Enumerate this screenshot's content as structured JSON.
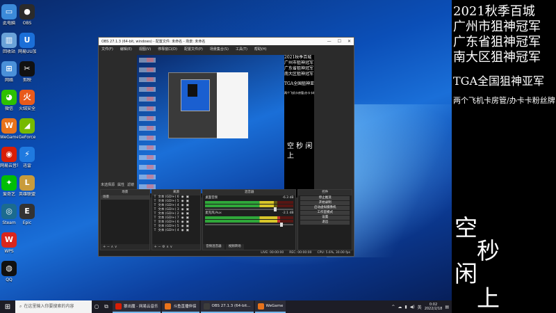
{
  "desktop": {
    "icons": [
      {
        "label": "此电脑",
        "icon": "computer-icon",
        "color": "#3b8ad9",
        "glyph": "▭"
      },
      {
        "label": "回收站",
        "icon": "recycle-bin-icon",
        "color": "#6aa2d8",
        "glyph": "▥"
      },
      {
        "label": "网络",
        "icon": "network-icon",
        "color": "#4a90d9",
        "glyph": "⊞"
      },
      {
        "label": "微信",
        "icon": "wechat-icon",
        "color": "#2dc100",
        "glyph": "◕"
      },
      {
        "label": "WeGame",
        "icon": "wegame-icon",
        "color": "#e8731b",
        "glyph": "W"
      },
      {
        "label": "网易云音乐",
        "icon": "netease-music-icon",
        "color": "#d81e06",
        "glyph": "◉"
      },
      {
        "label": "爱奇艺",
        "icon": "iqiyi-icon",
        "color": "#00be06",
        "glyph": "✦"
      },
      {
        "label": "Steam",
        "icon": "steam-icon",
        "color": "#1b6b8f",
        "glyph": "◎"
      },
      {
        "label": "WPS",
        "icon": "wps-icon",
        "color": "#d9261c",
        "glyph": "W"
      },
      {
        "label": "QQ",
        "icon": "qq-icon",
        "color": "#111111",
        "glyph": "◍"
      },
      {
        "label": "OBS",
        "icon": "obs-icon",
        "color": "#2b2b2b",
        "glyph": "●"
      },
      {
        "label": "网易UU加速器",
        "icon": "uu-accelerator-icon",
        "color": "#1b6fd8",
        "glyph": "U"
      },
      {
        "label": "剪映",
        "icon": "capcut-icon",
        "color": "#111111",
        "glyph": "✂"
      },
      {
        "label": "火绒安全",
        "icon": "huorong-icon",
        "color": "#e85a1b",
        "glyph": "火"
      },
      {
        "label": "GeForce",
        "icon": "geforce-icon",
        "color": "#76b900",
        "glyph": "◢"
      },
      {
        "label": "迅雷",
        "icon": "thunder-icon",
        "color": "#1f7ae0",
        "glyph": "⚡"
      },
      {
        "label": "英雄联盟",
        "icon": "lol-icon",
        "color": "#c89b3c",
        "glyph": "L"
      },
      {
        "label": "Epic",
        "icon": "epic-icon",
        "color": "#333333",
        "glyph": "E"
      }
    ]
  },
  "obs": {
    "title": "OBS 27.1.3 (64-bit, windows) - 配置文件: 未命名 - 场景: 未命名",
    "window_controls": [
      "—",
      "☐",
      "✕"
    ],
    "menu": [
      "文件(F)",
      "编辑(E)",
      "视图(V)",
      "停靠窗口(D)",
      "配置文件(P)",
      "场景集合(S)",
      "工具(T)",
      "帮助(H)"
    ],
    "preview_overlay": {
      "lines": [
        "2021秋季百城",
        "广州市狙神冠军",
        "广东省狙神冠军",
        "南大区狙神冠军",
        "TGA全国狙神亚军"
      ],
      "small": "两个飞机卡房管/办卡卡粉丝牌",
      "big": "空 秒 闲 上"
    },
    "scene_bar": [
      "未选择源",
      "属性",
      "滤镜"
    ],
    "docks": {
      "scenes": {
        "title": "场景",
        "items": [
          "场景"
        ]
      },
      "sources": {
        "title": "来源",
        "items": [
          "文本 (GDI+) 6",
          "文本 (GDI+) 5",
          "文本 (GDI+) 4",
          "文本 (GDI+) 3",
          "文本 (GDI+) 2",
          "文本 (GDI+) 7",
          "文本 (GDI+) 6",
          "文本 (GDI+) 5",
          "文本 (GDI+) 4"
        ]
      },
      "mixer": {
        "title": "混音器",
        "channels": [
          {
            "name": "桌面音频",
            "db": "-6.3 dB",
            "level": 0.78
          },
          {
            "name": "麦克风/Aux",
            "db": "-2.1 dB",
            "level": 0.85
          }
        ],
        "tabs": [
          "音频混音器",
          "视频转场"
        ]
      },
      "controls": {
        "title": "控件",
        "buttons": [
          "停止推流",
          "开始录制",
          "启动虚拟摄像机",
          "工作室模式",
          "设置",
          "退出"
        ]
      }
    },
    "status": [
      "LIVE: 00:00:00",
      "REC: 00:00:00",
      "CPU: 5.6%, 30.00 fps"
    ]
  },
  "taskbar": {
    "search_placeholder": "在这里输入你要搜索的内容",
    "apps": [
      {
        "label": "狼出魔 - 网易云音乐",
        "color": "#d81e06"
      },
      {
        "label": "斗鱼直播伴侣",
        "color": "#e8731b"
      },
      {
        "label": "OBS 27.1.3 (64-bit...",
        "color": "#3c3c3c"
      },
      {
        "label": "WeGame",
        "color": "#e8731b"
      }
    ],
    "tray": [
      "^",
      "☁",
      "▮",
      "◀)",
      "英"
    ],
    "time": "0:02",
    "date": "2022/2/18"
  },
  "overlay": {
    "lines": [
      "2021秋季百城",
      "广州市狙神冠军",
      "广东省狙神冠军",
      "南大区狙神冠军",
      "TGA全国狙神亚军",
      "两个飞机卡房管/办卡卡粉丝牌"
    ],
    "big_chars": [
      "空",
      "秒",
      "闲",
      "上"
    ]
  }
}
